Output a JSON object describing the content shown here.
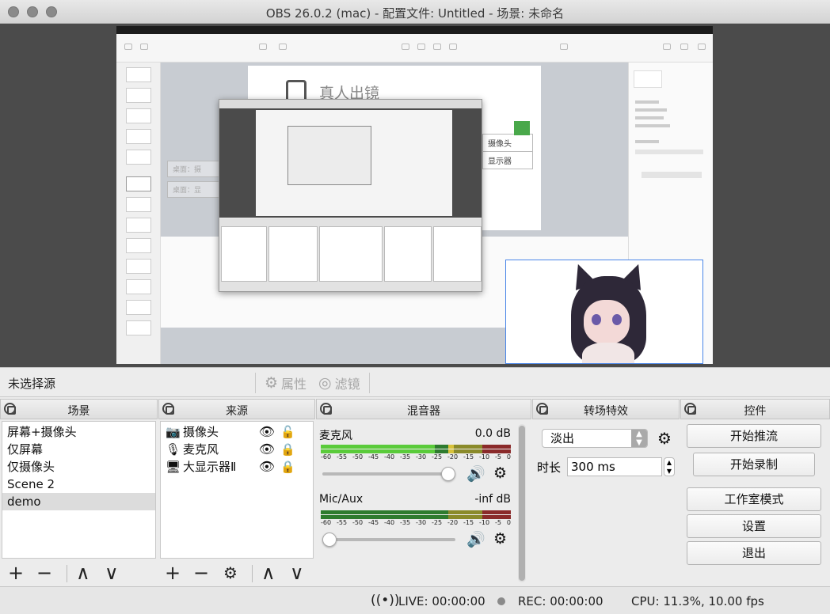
{
  "window": {
    "title": "OBS 26.0.2 (mac) - 配置文件: Untitled - 场景: 未命名"
  },
  "preview": {
    "slide_title": "真人出镜",
    "box_camera": "摄像头",
    "box_display": "显示器",
    "box_left1": "桌面：摄",
    "box_left2": "桌面：显"
  },
  "context_bar": {
    "no_source": "未选择源",
    "properties_label": "属性",
    "filters_label": "滤镜"
  },
  "scenes": {
    "title": "场景",
    "items": [
      "屏幕+摄像头",
      "仅屏幕",
      "仅摄像头",
      "Scene 2",
      "demo"
    ],
    "selected_index": 4
  },
  "sources": {
    "title": "来源",
    "items": [
      {
        "icon": "camera-icon",
        "label": "摄像头",
        "locked": false
      },
      {
        "icon": "microphone-icon",
        "label": "麦克风",
        "locked": true
      },
      {
        "icon": "monitor-icon",
        "label": "大显示器Ⅱ",
        "locked": true
      }
    ]
  },
  "mixer": {
    "title": "混音器",
    "ticks": [
      "-60",
      "-55",
      "-50",
      "-45",
      "-40",
      "-35",
      "-30",
      "-25",
      "-20",
      "-15",
      "-10",
      "-5",
      "0"
    ],
    "tracks": [
      {
        "name": "麦克风",
        "db": "0.0 dB",
        "volume": 1.0
      },
      {
        "name": "Mic/Aux",
        "db": "-inf dB",
        "volume": 0.0
      }
    ]
  },
  "transitions": {
    "title": "转场特效",
    "selected": "淡出",
    "duration_label": "时长",
    "duration_value": "300 ms"
  },
  "controls": {
    "title": "控件",
    "start_stream": "开始推流",
    "start_record": "开始录制",
    "studio_mode": "工作室模式",
    "settings": "设置",
    "exit": "退出"
  },
  "status": {
    "live": "LIVE: 00:00:00",
    "rec": "REC: 00:00:00",
    "cpu": "CPU: 11.3%, 10.00 fps"
  },
  "colors": {
    "accent_blue": "#4a86e8",
    "meter_green": "#5acb3a",
    "meter_yellow": "#d8c23a",
    "meter_red": "#8a2a2a"
  }
}
